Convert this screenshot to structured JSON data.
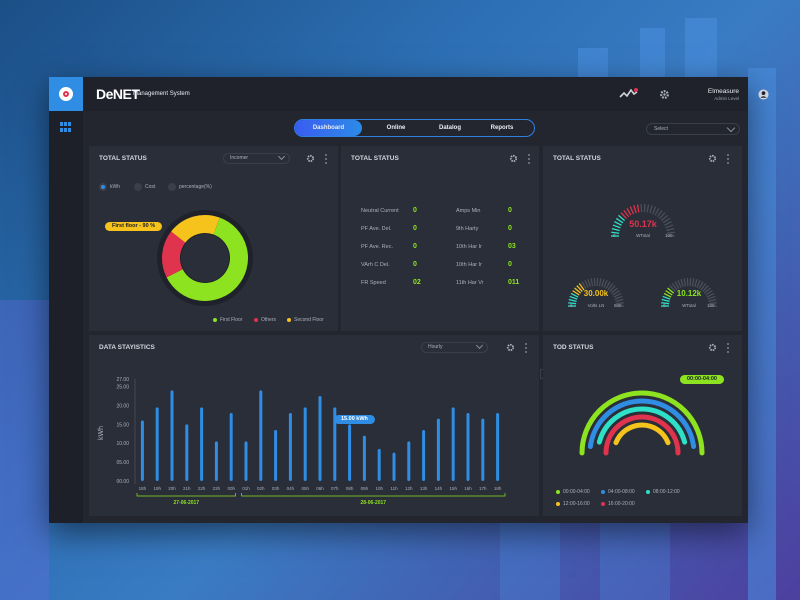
{
  "app": {
    "brand": "DeNET",
    "brand_sub": "Management System",
    "user_name": "Elmeasure",
    "user_role": "Admin Level"
  },
  "tabs": [
    "Dashboard",
    "Online",
    "Datalog",
    "Reports"
  ],
  "active_tab": "Dashboard",
  "select_placeholder": "Select",
  "panel1": {
    "title": "TOTAL STATUS",
    "dropdown": "Incomer",
    "radios": [
      "kWh",
      "Cost",
      "percentage(%)"
    ],
    "callout": "First floor - 90 %",
    "donut": [
      {
        "label": "First Floor",
        "value": 62,
        "color": "#8de31f"
      },
      {
        "label": "Others",
        "value": 18,
        "color": "#e0334d"
      },
      {
        "label": "Second Floor",
        "value": 20,
        "color": "#f5c31c"
      }
    ]
  },
  "panel2": {
    "title": "TOTAL STATUS",
    "rows_left": [
      {
        "label": "Neutral Current",
        "value": "0"
      },
      {
        "label": "PF Ave. Del.",
        "value": "0"
      },
      {
        "label": "PF Ave. Rec.",
        "value": "0"
      },
      {
        "label": "VArh C Del.",
        "value": "0"
      },
      {
        "label": "FR Speed",
        "value": "02"
      }
    ],
    "rows_right": [
      {
        "label": "Amps Min",
        "value": "0"
      },
      {
        "label": "9th Harty",
        "value": "0"
      },
      {
        "label": "10th Har Ir",
        "value": "03"
      },
      {
        "label": "10th Har Ir",
        "value": "0"
      },
      {
        "label": "11th Har Vr",
        "value": "011"
      }
    ]
  },
  "panel3": {
    "title": "TOTAL STATUS",
    "gauges": [
      {
        "value": "50.17k",
        "label": "WTotal",
        "min": "0",
        "max": "100",
        "color": "#e0334d",
        "level": 0.45
      },
      {
        "value": "30.00k",
        "label": "Volts LN",
        "min": "0",
        "max": "500",
        "color": "#f5c31c",
        "level": 0.3
      },
      {
        "value": "10.12k",
        "label": "WTotal",
        "min": "0",
        "max": "100",
        "color": "#8de31f",
        "level": 0.25
      }
    ]
  },
  "panel4": {
    "title": "DATA STAYISTICS",
    "dropdown": "Hourly",
    "ylabel": "kWh",
    "callout": "15.00 kWh",
    "date_left": "27-06-2017",
    "date_right": "28-06-2017",
    "pager_prev": "<",
    "pager_next": ">"
  },
  "chart_data": {
    "type": "bar",
    "ylabel": "kWh",
    "yticks": [
      "27.00",
      "25.00",
      "20.00",
      "15.00",
      "10.00",
      "05.00",
      "00.00"
    ],
    "ylim": [
      0,
      27
    ],
    "categories": [
      "18h",
      "19h",
      "20h",
      "21h",
      "22h",
      "23h",
      "00h",
      "01h",
      "02h",
      "03h",
      "04h",
      "05h",
      "06h",
      "07h",
      "08h",
      "09h",
      "10h",
      "11h",
      "12h",
      "13h",
      "14h",
      "15h",
      "16h",
      "17h",
      "18h"
    ],
    "values": [
      16,
      19.5,
      24,
      15,
      19.5,
      10.5,
      18,
      10.5,
      24,
      13.5,
      18,
      19.5,
      22.5,
      19.5,
      15,
      12,
      8.5,
      7.5,
      10.5,
      13.5,
      16.5,
      19.5,
      18,
      16.5,
      18
    ],
    "color": "#2f8de4"
  },
  "panel5": {
    "title": "TOD STATUS",
    "callout": "00:00-04:00",
    "legend": [
      {
        "label": "00:00-04:00",
        "color": "#8de31f"
      },
      {
        "label": "04:00-08:00",
        "color": "#2f8de4"
      },
      {
        "label": "08:00-12:00",
        "color": "#2ee0c8"
      },
      {
        "label": "12:00-16:00",
        "color": "#f5c31c"
      },
      {
        "label": "16:00-20:00",
        "color": "#e0334d"
      }
    ]
  }
}
